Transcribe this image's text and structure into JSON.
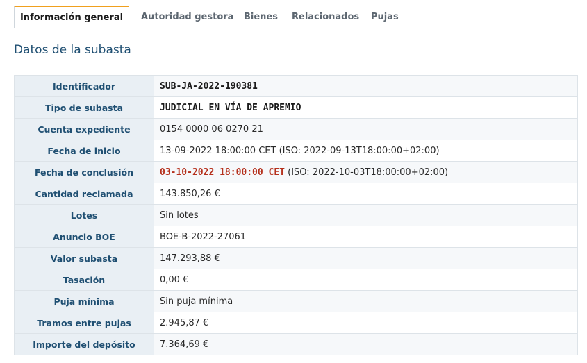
{
  "tabs": [
    {
      "label": "Información general"
    },
    {
      "label": "Autoridad gestora"
    },
    {
      "label": "Bienes"
    },
    {
      "label": "Relacionados"
    },
    {
      "label": "Pujas"
    }
  ],
  "section_title": "Datos de la subasta",
  "rows": {
    "identificador": {
      "label": "Identificador",
      "value": "SUB-JA-2022-190381"
    },
    "tipo": {
      "label": "Tipo de subasta",
      "value": "JUDICIAL EN VÍA DE APREMIO"
    },
    "cuenta": {
      "label": "Cuenta expediente",
      "value": "0154 0000 06 0270 21"
    },
    "inicio": {
      "label": "Fecha de inicio",
      "value": "13-09-2022 18:00:00 CET (ISO: 2022-09-13T18:00:00+02:00)"
    },
    "conclusion": {
      "label": "Fecha de conclusión",
      "value_highlight": "03-10-2022 18:00:00 CET",
      "value_rest": " (ISO: 2022-10-03T18:00:00+02:00)"
    },
    "cantidad": {
      "label": "Cantidad reclamada",
      "value": "143.850,26 €"
    },
    "lotes": {
      "label": "Lotes",
      "value": "Sin lotes"
    },
    "boe": {
      "label": "Anuncio BOE",
      "value": "BOE-B-2022-27061"
    },
    "valor": {
      "label": "Valor subasta",
      "value": "147.293,88 €"
    },
    "tasacion": {
      "label": "Tasación",
      "value": "0,00 €"
    },
    "puja_minima": {
      "label": "Puja mínima",
      "value": "Sin puja mínima"
    },
    "tramos": {
      "label": "Tramos entre pujas",
      "value": "2.945,87 €"
    },
    "deposito": {
      "label": "Importe del depósito",
      "value": "7.364,69 €"
    }
  },
  "colors": {
    "accent": "#f0a01e",
    "title": "#1f4f72",
    "highlight": "#b5301c"
  }
}
